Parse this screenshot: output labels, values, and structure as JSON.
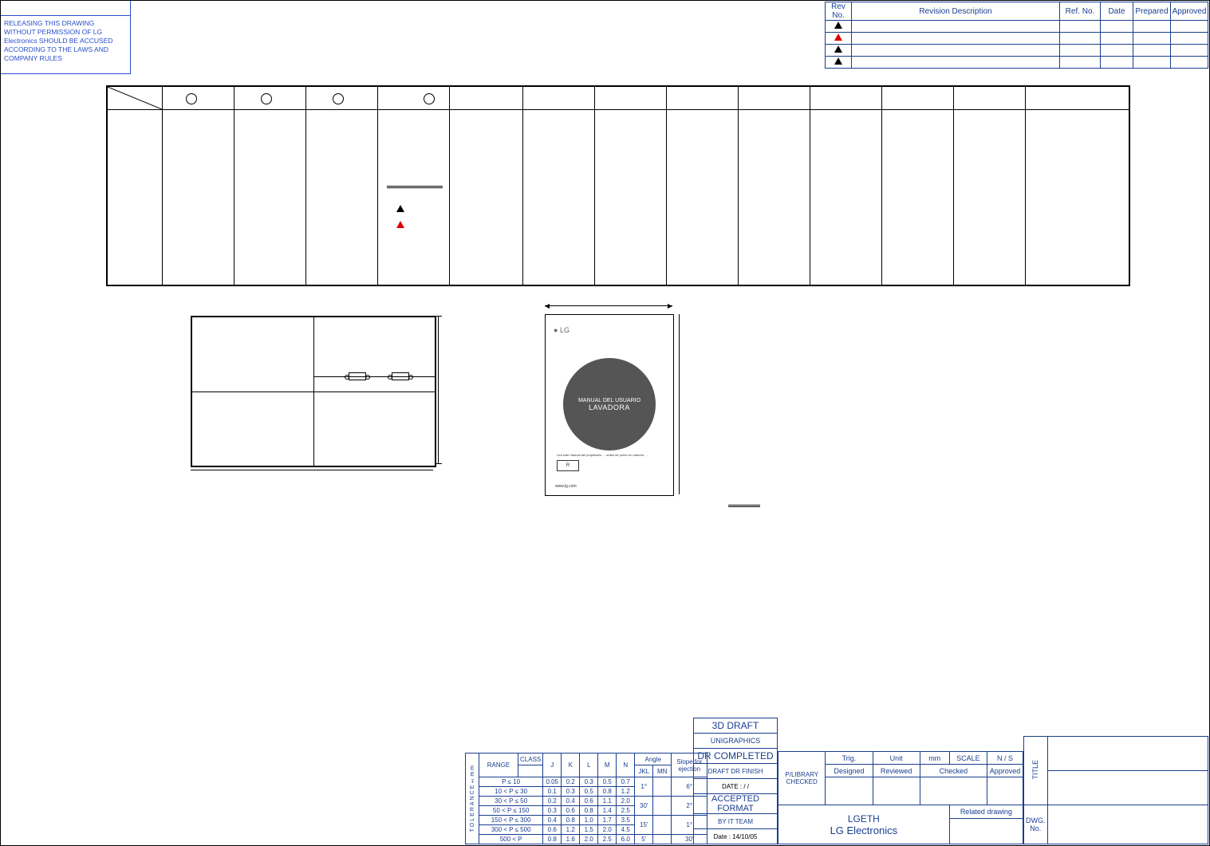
{
  "legal": "RELEASING THIS DRAWING WITHOUT PERMISSION OF LG Electronics SHOULD BE ACCUSED ACCORDING TO THE LAWS AND COMPANY RULES",
  "revision_table": {
    "headers": [
      "Rev No.",
      "Revision Description",
      "Ref. No.",
      "Date",
      "Prepared",
      "Approved"
    ],
    "rows": [
      [
        "",
        "",
        "",
        "",
        "",
        ""
      ],
      [
        "",
        "",
        "",
        "",
        "",
        ""
      ],
      [
        "",
        "",
        "",
        "",
        "",
        ""
      ]
    ]
  },
  "manual_cover": {
    "brand": "LG",
    "line1": "MANUAL DEL USUARIO",
    "line2": "LAVADORA",
    "note": "Lea este manual del propietario … antes de poner en marcha …",
    "r_label": "R",
    "footer": "www.lg.com"
  },
  "tolerance": {
    "side_label": "TOLERANCE±mm",
    "range_label": "RANGE",
    "class_label": "CLASS",
    "cols": [
      "J",
      "K",
      "L",
      "M",
      "N"
    ],
    "angle_label": "Angle",
    "subcols": [
      "JKL",
      "MN"
    ],
    "slope_label": "Slope for ejection",
    "rows": [
      {
        "range": "P ≤ 10",
        "vals": [
          "0.05",
          "0.2",
          "0.3",
          "0.5",
          "0.7"
        ],
        "a": "1°",
        "s": "6°"
      },
      {
        "range": "10 < P ≤ 30",
        "vals": [
          "0.1",
          "0.3",
          "0.5",
          "0.8",
          "1.2"
        ],
        "a": "",
        "s": ""
      },
      {
        "range": "30 < P ≤ 50",
        "vals": [
          "0.2",
          "0.4",
          "0.6",
          "1.1",
          "2.0"
        ],
        "a": "30'",
        "s": "2°"
      },
      {
        "range": "50 < P ≤ 150",
        "vals": [
          "0.3",
          "0.6",
          "0.8",
          "1.4",
          "2.5"
        ],
        "a": "",
        "s": ""
      },
      {
        "range": "150 < P ≤ 300",
        "vals": [
          "0.4",
          "0.8",
          "1.0",
          "1.7",
          "3.5"
        ],
        "a": "15'",
        "s": "1°"
      },
      {
        "range": "300 < P ≤ 500",
        "vals": [
          "0.6",
          "1.2",
          "1.5",
          "2.0",
          "4.5"
        ],
        "a": "",
        "s": ""
      },
      {
        "range": "500 < P",
        "vals": [
          "0.8",
          "1.6",
          "2.0",
          "2.5",
          "6.0"
        ],
        "a": "5'",
        "s": "30'"
      }
    ]
  },
  "cad_block": {
    "l1": "3D DRAFT",
    "l2": "UNIGRAPHICS",
    "l3": "DR COMPLETED",
    "l4": "DRAFT DR FINISH",
    "l5": "DATE :    /    /",
    "l6": "ACCEPTED FORMAT",
    "l7": "BY IT TEAM",
    "l8": "Date : 14/10/05"
  },
  "sign_block": {
    "lib": "P/LIBRARY CHECKED",
    "row1": [
      "Trig.",
      "Unit",
      "mm",
      "SCALE",
      "N / S"
    ],
    "row2": [
      "Designed",
      "Reviewed",
      "Checked",
      "Approved"
    ]
  },
  "org_block": {
    "l1": "LGETH",
    "l2": "LG Electronics",
    "related": "Related drawing"
  },
  "right_block": {
    "title": "TITLE",
    "dwg": "DWG. No."
  }
}
